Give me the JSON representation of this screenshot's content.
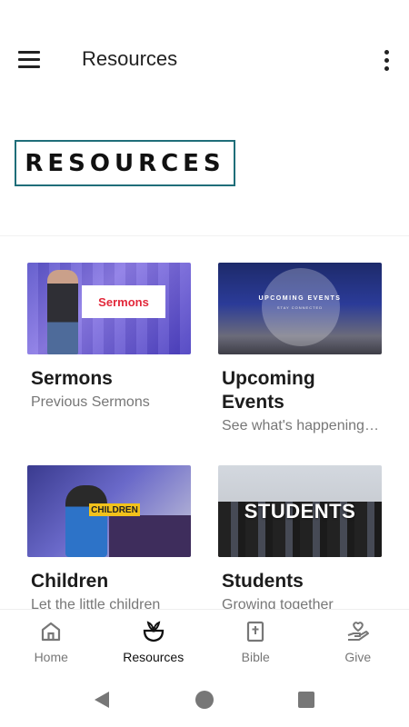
{
  "app_bar": {
    "title": "Resources",
    "menu_icon": "hamburger-menu-icon",
    "more_icon": "more-vertical-icon"
  },
  "banner": {
    "text": "RESOURCES",
    "border_color": "#1f6e79"
  },
  "cards": [
    {
      "title": "Sermons",
      "subtitle": "Previous Sermons",
      "thumb_text": "Sermons"
    },
    {
      "title": "Upcoming Events",
      "subtitle": "See what's happening at our church",
      "thumb_title": "UPCOMING EVENTS",
      "thumb_sub": "STAY CONNECTED"
    },
    {
      "title": "Children",
      "subtitle": "Let the little children",
      "thumb_text": "CHILDREN"
    },
    {
      "title": "Students",
      "subtitle": "Growing together",
      "thumb_text": "STUDENTS"
    }
  ],
  "bottom_nav": {
    "items": [
      {
        "label": "Home",
        "icon": "home-icon"
      },
      {
        "label": "Resources",
        "icon": "resources-icon",
        "active": true
      },
      {
        "label": "Bible",
        "icon": "bible-icon"
      },
      {
        "label": "Give",
        "icon": "give-hand-heart-icon"
      }
    ]
  },
  "colors": {
    "accent": "#1f6e79",
    "sermons_red": "#e2283a",
    "children_yellow": "#f2c21b",
    "inactive_nav": "#777777"
  }
}
